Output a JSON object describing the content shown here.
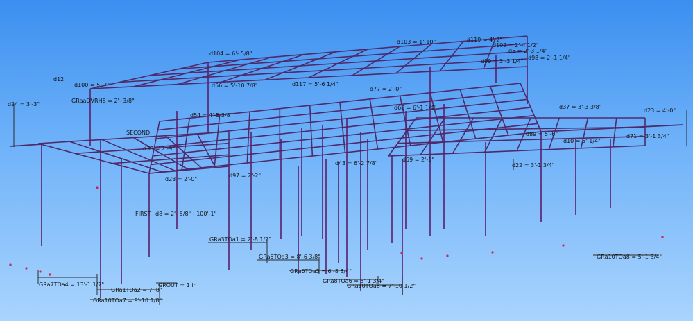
{
  "viewport": {
    "frame_color": "#5a1e6b",
    "grid_color": "#4e2a6a",
    "dim_color": "#2b2b2b",
    "marker_color": "#c8245a",
    "background_top": "#3b8ff0",
    "background_bottom": "#a9d4fd"
  },
  "dimension_labels": [
    "d104 = 6'- 5/8\"",
    "d103 = 1'-10\"",
    "d119 = 4'-2\"",
    "d102 = 2'-4 1/2\"",
    "d5 = 2'-3 1/4\"",
    "d99 = 3'-3 1/4\"",
    "d98 = 2'-1 1/4\"",
    "d12",
    "d100 = 5'-7\"",
    "GRaaOVRH8 = 2'- 3/8\"",
    "d24 = 3'-3\"",
    "d56 = 5'-10 7/8\"",
    "d117 = 5'-6 1/4\"",
    "d77 = 2'-0\"",
    "d37 = 3'-3 3/8\"",
    "d23 = 4'-0\"",
    "d54 = 4'-5 3/8\"",
    "SECOND",
    "d68 = 6'-1 1/4\"",
    "d38 = 2'-9\"",
    "d89 = 5'-6\"",
    "d71 = 3'-1 3/4\"",
    "d10 = 5'-1/4\"",
    "d43 = 6'-2 7/8\"",
    "d59 = 2'-1\"",
    "d22 = 3'-1 3/4\"",
    "d28 = 2'-0\"",
    "d97 = 2'-2\"",
    "FIRST",
    "d8 = 2'- 5/8\" - 100'-1\"",
    "GRa3TOa1 = 2'-8 1/2\"",
    "GRa5TOa3 = 8'-6 3/8\"",
    "GRa6TOa5 = 6'-8 3/4\"",
    "GRa8TOa6 = 5'-1 3/4\"",
    "GRa10TOa8 = 7'-10 1/2\"",
    "GRa7TOa4 = 13'-1 1/2\"",
    "GRa1TOa2 = 7'-8\"",
    "GRa10TOa7 = 9'-10 1/8\"",
    "GROUT = 1 in",
    "GRa10TOa8 = 5'-1 3/4\""
  ]
}
